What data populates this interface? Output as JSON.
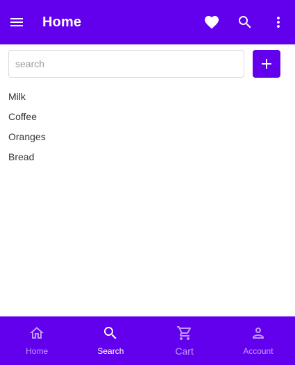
{
  "app_bar": {
    "title": "Home",
    "background_color": "#6200ee",
    "icons": [
      "menu-icon",
      "heart-icon",
      "search-icon",
      "more-vertical-icon"
    ]
  },
  "search": {
    "placeholder": "search",
    "value": "",
    "add_button_icon": "plus-icon"
  },
  "items": [
    {
      "label": "Milk"
    },
    {
      "label": "Coffee"
    },
    {
      "label": "Oranges"
    },
    {
      "label": "Bread"
    }
  ],
  "bottom_nav": {
    "active": "Search",
    "items": [
      {
        "label": "Home",
        "icon": "home-icon"
      },
      {
        "label": "Search",
        "icon": "search-icon"
      },
      {
        "label": "Cart",
        "icon": "cart-icon"
      },
      {
        "label": "Account",
        "icon": "account-icon"
      }
    ]
  }
}
